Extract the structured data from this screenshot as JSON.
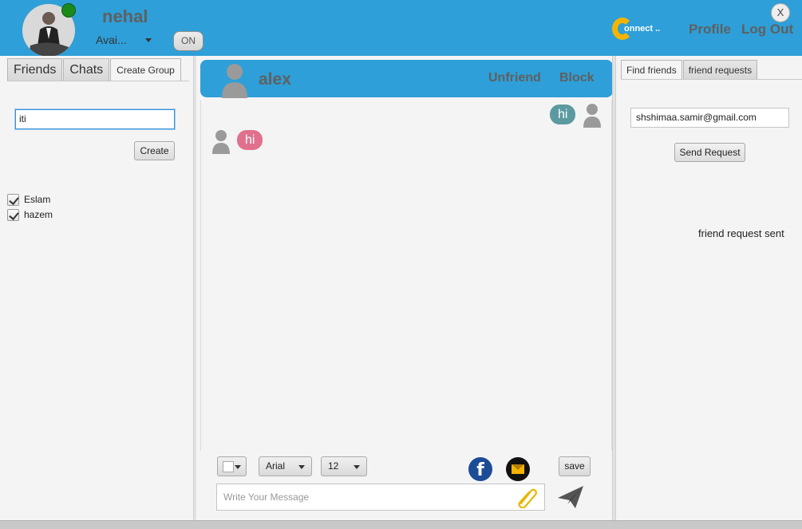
{
  "header": {
    "username": "nehal",
    "status_value": "Avai...",
    "toggle_label": "ON",
    "logo_text": "onnect ..",
    "profile_link": "Profile",
    "logout_link": "Log Out",
    "close_label": "X"
  },
  "left_panel": {
    "tabs": [
      {
        "label": "Friends"
      },
      {
        "label": "Chats"
      },
      {
        "label": "Create Group"
      }
    ],
    "group_name_value": "iti",
    "create_button": "Create",
    "friends": [
      {
        "label": "Eslam",
        "checked": true
      },
      {
        "label": "hazem",
        "checked": true
      }
    ]
  },
  "chat": {
    "contact_name": "alex",
    "unfriend_link": "Unfriend",
    "block_link": "Block",
    "messages": [
      {
        "direction": "out",
        "text": "hi"
      },
      {
        "direction": "in",
        "text": "hi"
      }
    ]
  },
  "toolbar": {
    "font_family": "Arial",
    "font_size": "12",
    "facebook_glyph": "f",
    "save_button": "save",
    "message_placeholder": "Write Your Message"
  },
  "right_panel": {
    "tabs": [
      {
        "label": "Find friends"
      },
      {
        "label": "friend requests"
      }
    ],
    "email_value": "shshimaa.samir@gmail.com",
    "send_request_button": "Send Request",
    "status_text": "friend request sent"
  },
  "colors": {
    "header_blue": "#2e9fd8",
    "outgoing_bubble": "#5b9aa0",
    "incoming_bubble": "#e0708d",
    "online_status": "#1a8a1a",
    "accent_yellow": "#f5b400"
  },
  "icons": [
    "user-avatar-icon",
    "online-status-icon",
    "person-icon",
    "facebook-icon",
    "mail-icon",
    "paperclip-icon",
    "send-icon",
    "chevron-down-icon",
    "checkbox-checked-icon"
  ]
}
